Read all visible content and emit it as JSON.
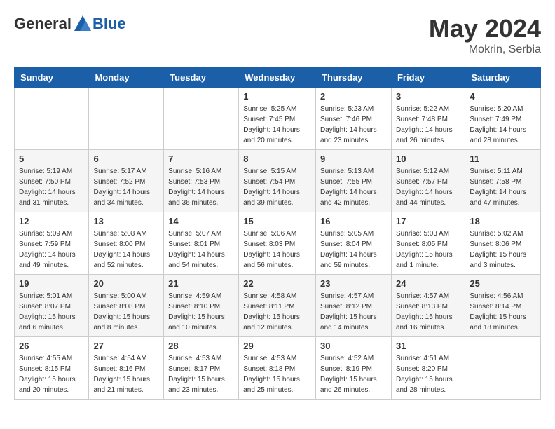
{
  "header": {
    "logo_general": "General",
    "logo_blue": "Blue",
    "month_year": "May 2024",
    "location": "Mokrin, Serbia"
  },
  "days_of_week": [
    "Sunday",
    "Monday",
    "Tuesday",
    "Wednesday",
    "Thursday",
    "Friday",
    "Saturday"
  ],
  "weeks": [
    [
      {
        "day": "",
        "info": ""
      },
      {
        "day": "",
        "info": ""
      },
      {
        "day": "",
        "info": ""
      },
      {
        "day": "1",
        "info": "Sunrise: 5:25 AM\nSunset: 7:45 PM\nDaylight: 14 hours\nand 20 minutes."
      },
      {
        "day": "2",
        "info": "Sunrise: 5:23 AM\nSunset: 7:46 PM\nDaylight: 14 hours\nand 23 minutes."
      },
      {
        "day": "3",
        "info": "Sunrise: 5:22 AM\nSunset: 7:48 PM\nDaylight: 14 hours\nand 26 minutes."
      },
      {
        "day": "4",
        "info": "Sunrise: 5:20 AM\nSunset: 7:49 PM\nDaylight: 14 hours\nand 28 minutes."
      }
    ],
    [
      {
        "day": "5",
        "info": "Sunrise: 5:19 AM\nSunset: 7:50 PM\nDaylight: 14 hours\nand 31 minutes."
      },
      {
        "day": "6",
        "info": "Sunrise: 5:17 AM\nSunset: 7:52 PM\nDaylight: 14 hours\nand 34 minutes."
      },
      {
        "day": "7",
        "info": "Sunrise: 5:16 AM\nSunset: 7:53 PM\nDaylight: 14 hours\nand 36 minutes."
      },
      {
        "day": "8",
        "info": "Sunrise: 5:15 AM\nSunset: 7:54 PM\nDaylight: 14 hours\nand 39 minutes."
      },
      {
        "day": "9",
        "info": "Sunrise: 5:13 AM\nSunset: 7:55 PM\nDaylight: 14 hours\nand 42 minutes."
      },
      {
        "day": "10",
        "info": "Sunrise: 5:12 AM\nSunset: 7:57 PM\nDaylight: 14 hours\nand 44 minutes."
      },
      {
        "day": "11",
        "info": "Sunrise: 5:11 AM\nSunset: 7:58 PM\nDaylight: 14 hours\nand 47 minutes."
      }
    ],
    [
      {
        "day": "12",
        "info": "Sunrise: 5:09 AM\nSunset: 7:59 PM\nDaylight: 14 hours\nand 49 minutes."
      },
      {
        "day": "13",
        "info": "Sunrise: 5:08 AM\nSunset: 8:00 PM\nDaylight: 14 hours\nand 52 minutes."
      },
      {
        "day": "14",
        "info": "Sunrise: 5:07 AM\nSunset: 8:01 PM\nDaylight: 14 hours\nand 54 minutes."
      },
      {
        "day": "15",
        "info": "Sunrise: 5:06 AM\nSunset: 8:03 PM\nDaylight: 14 hours\nand 56 minutes."
      },
      {
        "day": "16",
        "info": "Sunrise: 5:05 AM\nSunset: 8:04 PM\nDaylight: 14 hours\nand 59 minutes."
      },
      {
        "day": "17",
        "info": "Sunrise: 5:03 AM\nSunset: 8:05 PM\nDaylight: 15 hours\nand 1 minute."
      },
      {
        "day": "18",
        "info": "Sunrise: 5:02 AM\nSunset: 8:06 PM\nDaylight: 15 hours\nand 3 minutes."
      }
    ],
    [
      {
        "day": "19",
        "info": "Sunrise: 5:01 AM\nSunset: 8:07 PM\nDaylight: 15 hours\nand 6 minutes."
      },
      {
        "day": "20",
        "info": "Sunrise: 5:00 AM\nSunset: 8:08 PM\nDaylight: 15 hours\nand 8 minutes."
      },
      {
        "day": "21",
        "info": "Sunrise: 4:59 AM\nSunset: 8:10 PM\nDaylight: 15 hours\nand 10 minutes."
      },
      {
        "day": "22",
        "info": "Sunrise: 4:58 AM\nSunset: 8:11 PM\nDaylight: 15 hours\nand 12 minutes."
      },
      {
        "day": "23",
        "info": "Sunrise: 4:57 AM\nSunset: 8:12 PM\nDaylight: 15 hours\nand 14 minutes."
      },
      {
        "day": "24",
        "info": "Sunrise: 4:57 AM\nSunset: 8:13 PM\nDaylight: 15 hours\nand 16 minutes."
      },
      {
        "day": "25",
        "info": "Sunrise: 4:56 AM\nSunset: 8:14 PM\nDaylight: 15 hours\nand 18 minutes."
      }
    ],
    [
      {
        "day": "26",
        "info": "Sunrise: 4:55 AM\nSunset: 8:15 PM\nDaylight: 15 hours\nand 20 minutes."
      },
      {
        "day": "27",
        "info": "Sunrise: 4:54 AM\nSunset: 8:16 PM\nDaylight: 15 hours\nand 21 minutes."
      },
      {
        "day": "28",
        "info": "Sunrise: 4:53 AM\nSunset: 8:17 PM\nDaylight: 15 hours\nand 23 minutes."
      },
      {
        "day": "29",
        "info": "Sunrise: 4:53 AM\nSunset: 8:18 PM\nDaylight: 15 hours\nand 25 minutes."
      },
      {
        "day": "30",
        "info": "Sunrise: 4:52 AM\nSunset: 8:19 PM\nDaylight: 15 hours\nand 26 minutes."
      },
      {
        "day": "31",
        "info": "Sunrise: 4:51 AM\nSunset: 8:20 PM\nDaylight: 15 hours\nand 28 minutes."
      },
      {
        "day": "",
        "info": ""
      }
    ]
  ]
}
